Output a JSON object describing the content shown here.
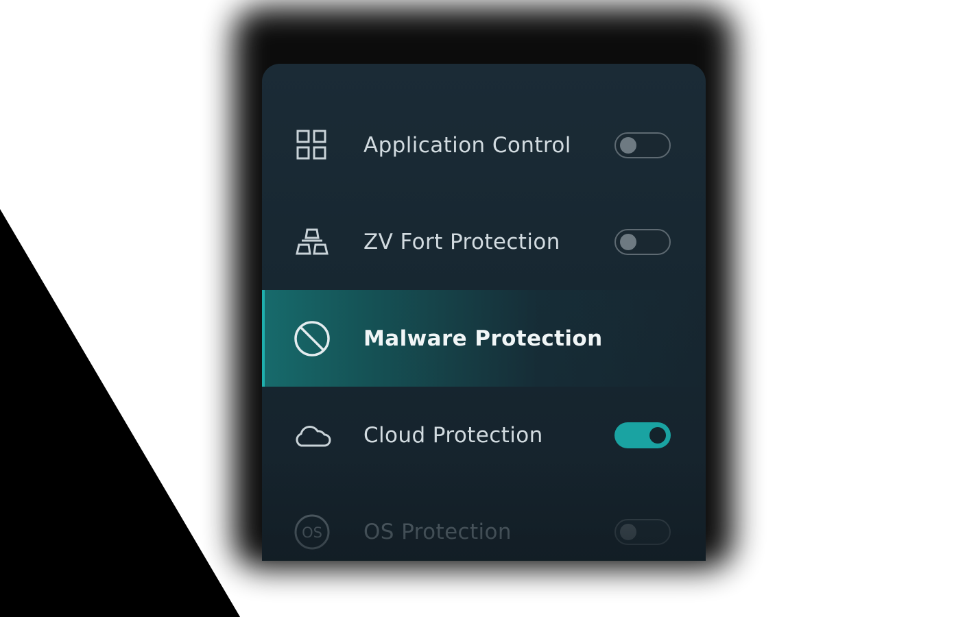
{
  "colors": {
    "panel_bg": "#172731",
    "accent": "#1aa3a2",
    "text": "#d2dbe0",
    "toggle_off": "#5e6a72"
  },
  "items": [
    {
      "label": "Application Control",
      "icon": "grid-icon",
      "toggle": "off",
      "active": false
    },
    {
      "label": "ZV Fort Protection",
      "icon": "stacked-blocks-icon",
      "toggle": "off",
      "active": false
    },
    {
      "label": "Malware Protection",
      "icon": "prohibited-icon",
      "toggle": null,
      "active": true
    },
    {
      "label": "Cloud Protection",
      "icon": "cloud-icon",
      "toggle": "on",
      "active": false
    },
    {
      "label": "OS Protection",
      "icon": "os-icon",
      "toggle": "off",
      "active": false
    }
  ],
  "os_badge_text": "OS"
}
